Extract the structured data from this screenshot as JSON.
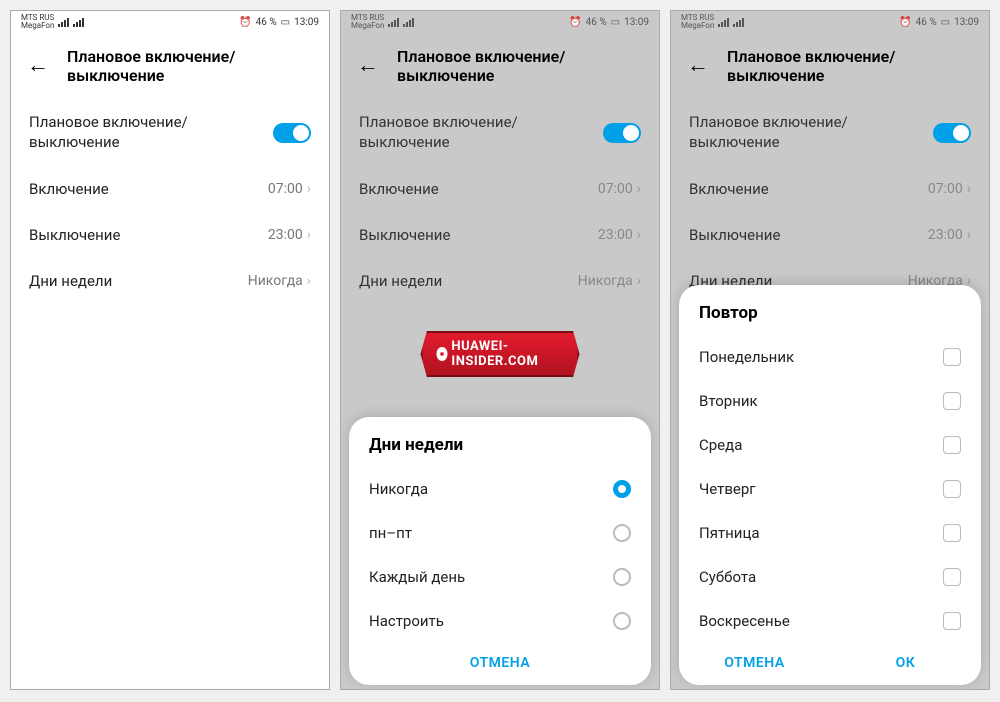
{
  "status": {
    "carrier1": "MTS RUS",
    "carrier2": "MegaFon",
    "battery": "46 %",
    "time": "13:09",
    "alarm_icon": "alarm-icon"
  },
  "header": {
    "title": "Плановое включение/выключение"
  },
  "rows": {
    "toggle_label": "Плановое включение/\nвыключение",
    "on_label": "Включение",
    "on_value": "07:00",
    "off_label": "Выключение",
    "off_value": "23:00",
    "days_label": "Дни недели",
    "days_value": "Никогда"
  },
  "sheet_days": {
    "title": "Дни недели",
    "options": [
      "Никогда",
      "пн–пт",
      "Каждый день",
      "Настроить"
    ],
    "selected_index": 0,
    "cancel": "ОТМЕНА"
  },
  "sheet_repeat": {
    "title": "Повтор",
    "options": [
      "Понедельник",
      "Вторник",
      "Среда",
      "Четверг",
      "Пятница",
      "Суббота",
      "Воскресенье"
    ],
    "cancel": "ОТМЕНА",
    "ok": "ОК"
  },
  "watermark": "HUAWEI-INSIDER.COM"
}
